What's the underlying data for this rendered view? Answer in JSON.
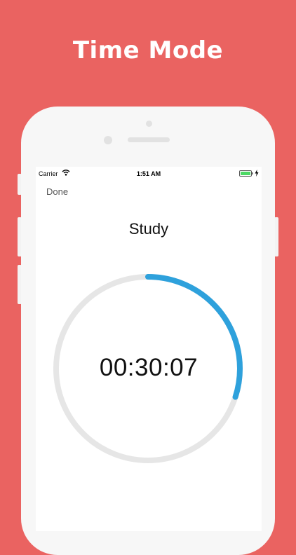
{
  "banner": {
    "title": "Time Mode"
  },
  "status_bar": {
    "carrier": "Carrier",
    "time": "1:51 AM"
  },
  "nav": {
    "done_label": "Done"
  },
  "timer": {
    "title": "Study",
    "elapsed": "00:30:07",
    "progress": 0.3,
    "progress_color": "#2ea1dc",
    "track_color": "#e6e6e6"
  },
  "colors": {
    "background": "#ea6361",
    "battery": "#4cd964"
  }
}
